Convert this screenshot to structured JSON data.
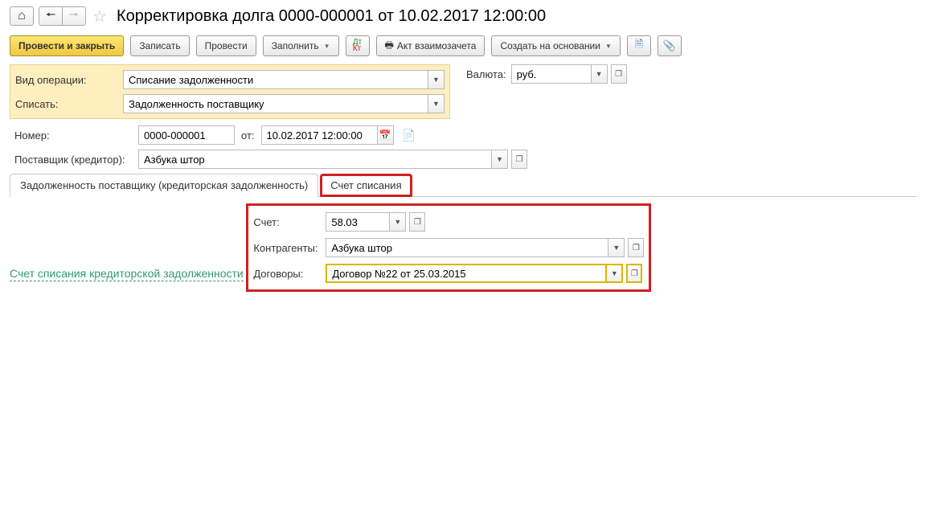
{
  "title": "Корректировка долга 0000-000001 от 10.02.2017 12:00:00",
  "toolbar": {
    "post_close": "Провести и закрыть",
    "save": "Записать",
    "post": "Провести",
    "fill": "Заполнить",
    "act": "Акт взаимозачета",
    "create_base": "Создать на основании"
  },
  "fields": {
    "operation_type_label": "Вид операции:",
    "operation_type_value": "Списание задолженности",
    "writeoff_label": "Списать:",
    "writeoff_value": "Задолженность поставщику",
    "currency_label": "Валюта:",
    "currency_value": "руб.",
    "number_label": "Номер:",
    "number_value": "0000-000001",
    "from_label": "от:",
    "date_value": "10.02.2017 12:00:00",
    "supplier_label": "Поставщик (кредитор):",
    "supplier_value": "Азбука штор"
  },
  "tabs": {
    "tab1": "Задолженность поставщику (кредиторская задолженность)",
    "tab2": "Счет списания"
  },
  "writeoff_section": {
    "header": "Счет списания кредиторской задолженности",
    "account_label": "Счет:",
    "account_value": "58.03",
    "counterparty_label": "Контрагенты:",
    "counterparty_value": "Азбука штор",
    "contract_label": "Договоры:",
    "contract_value": "Договор №22 от 25.03.2015"
  }
}
